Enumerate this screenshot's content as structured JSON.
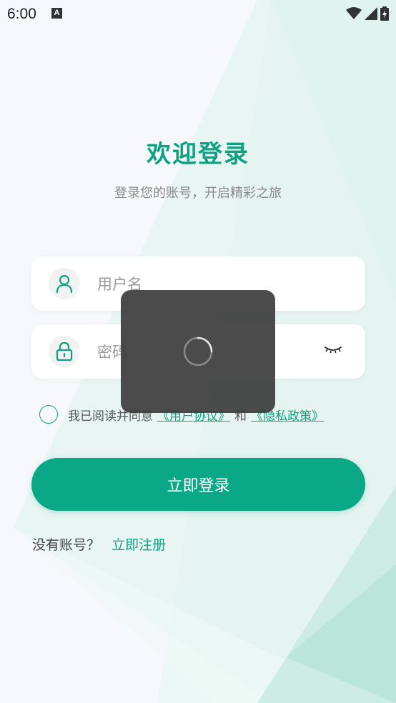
{
  "status_bar": {
    "time": "6:00",
    "notification_badge": "A"
  },
  "header": {
    "title": "欢迎登录",
    "subtitle": "登录您的账号，开启精彩之旅"
  },
  "form": {
    "username": {
      "placeholder": "用户名",
      "value": ""
    },
    "password": {
      "placeholder": "密码",
      "value": ""
    }
  },
  "agreement": {
    "prefix": "我已阅读并同意",
    "user_agreement": "《用户协议》",
    "conjunction": "和",
    "privacy_policy": "《隐私政策》",
    "checked": false
  },
  "login_button": "立即登录",
  "register": {
    "prompt": "没有账号？",
    "link": "立即注册"
  },
  "loading": {
    "visible": true
  },
  "colors": {
    "accent": "#0ea283",
    "button": "#0aa887",
    "overlay": "#3c3c3c"
  },
  "icons": [
    "user-icon",
    "lock-icon",
    "eye-closed-icon",
    "wifi-icon",
    "signal-icon",
    "battery-icon",
    "spinner-icon"
  ]
}
